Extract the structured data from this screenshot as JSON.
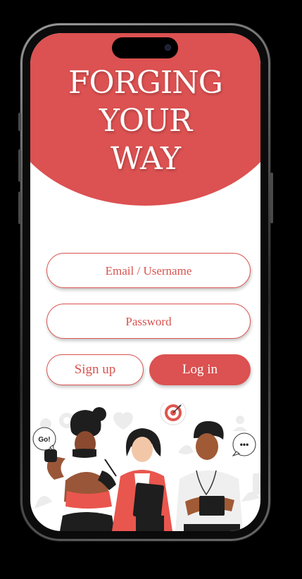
{
  "hero": {
    "title_lines": [
      "FORGING",
      "YOUR",
      "WAY"
    ]
  },
  "form": {
    "email_placeholder": "Email / Username",
    "password_placeholder": "Password"
  },
  "actions": {
    "signup_label": "Sign up",
    "login_label": "Log in"
  },
  "illustration": {
    "speech_bubble_left": "Go!",
    "speech_bubble_right": "•••",
    "icons": [
      "target-icon",
      "gear-icon",
      "heart-icon",
      "user-icon",
      "chart-icon"
    ]
  },
  "colors": {
    "accent": "#dc5151",
    "background": "#ffffff",
    "frame": "#000000"
  }
}
